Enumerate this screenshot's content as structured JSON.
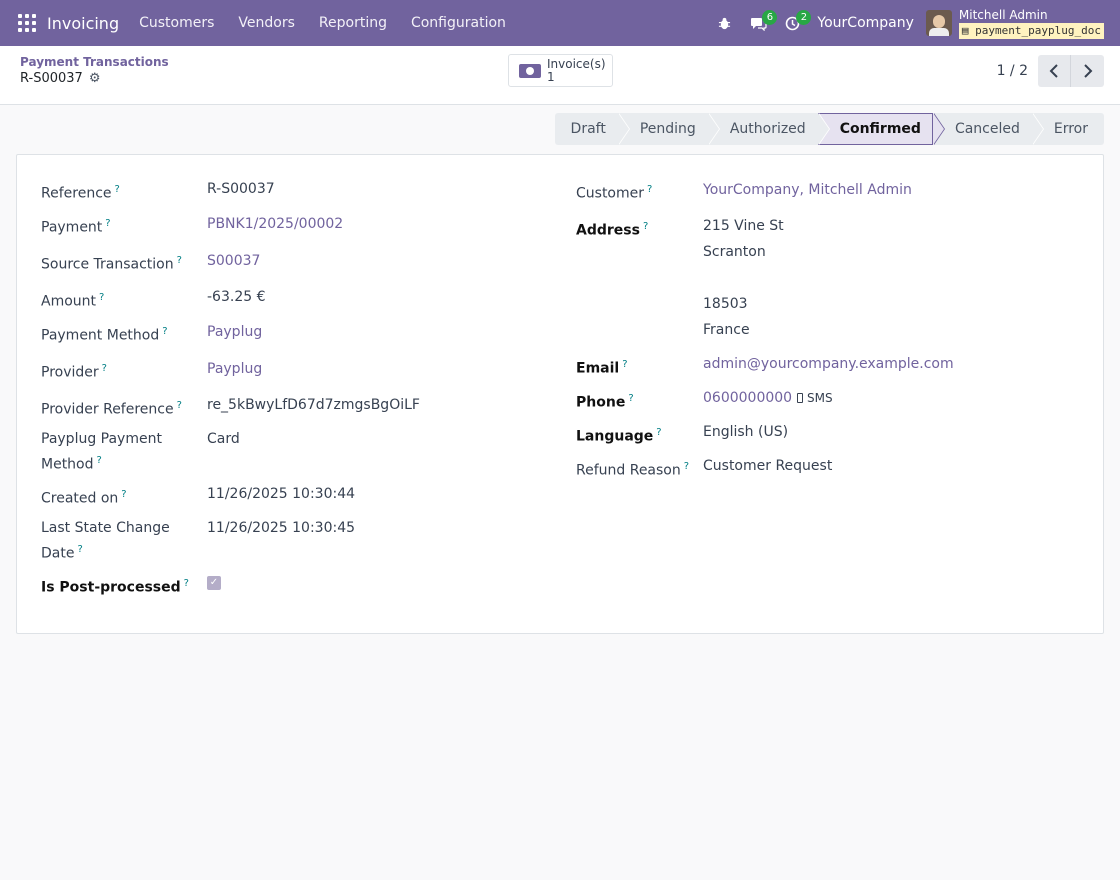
{
  "navbar": {
    "app_name": "Invoicing",
    "menu": [
      "Customers",
      "Vendors",
      "Reporting",
      "Configuration"
    ],
    "messages_count": "6",
    "activities_count": "2",
    "company": "YourCompany",
    "user_name": "Mitchell Admin",
    "database": "payment_payplug_doc"
  },
  "control": {
    "breadcrumb": "Payment Transactions",
    "record_name": "R-S00037",
    "smart_button_label": "Invoice(s)",
    "smart_button_count": "1",
    "pager": "1 / 2"
  },
  "status_stages": [
    "Draft",
    "Pending",
    "Authorized",
    "Confirmed",
    "Canceled",
    "Error"
  ],
  "active_stage": "Confirmed",
  "left_fields": {
    "reference": {
      "label": "Reference",
      "value": "R-S00037"
    },
    "payment": {
      "label": "Payment",
      "value": "PBNK1/2025/00002"
    },
    "source_transaction": {
      "label": "Source Transaction",
      "value": "S00037"
    },
    "amount": {
      "label": "Amount",
      "value": "-63.25 €"
    },
    "payment_method": {
      "label": "Payment Method",
      "value": "Payplug"
    },
    "provider": {
      "label": "Provider",
      "value": "Payplug"
    },
    "provider_reference": {
      "label": "Provider Reference",
      "value": "re_5kBwyLfD67d7zmgsBgOiLF"
    },
    "payplug_payment_method": {
      "label_line1": "Payplug Payment",
      "label_line2": "Method",
      "value": "Card"
    },
    "created_on": {
      "label": "Created on",
      "value": "11/26/2025 10:30:44"
    },
    "last_state_change": {
      "label_line1": "Last State Change",
      "label_line2": "Date",
      "value": "11/26/2025 10:30:45"
    },
    "is_post_processed": {
      "label": "Is Post-processed",
      "checked": true
    }
  },
  "right_fields": {
    "customer": {
      "label": "Customer",
      "value": "YourCompany, Mitchell Admin"
    },
    "address": {
      "label": "Address",
      "street": "215 Vine St",
      "city": "Scranton",
      "zip": "18503",
      "country": "France"
    },
    "email": {
      "label": "Email",
      "value": "admin@yourcompany.example.com"
    },
    "phone": {
      "label": "Phone",
      "value": "0600000000",
      "sms_label": "SMS"
    },
    "language": {
      "label": "Language",
      "value": "English (US)"
    },
    "refund_reason": {
      "label": "Refund Reason",
      "value": "Customer Request"
    }
  },
  "help_marker": "?",
  "colors": {
    "brand": "#71639e",
    "help": "#017e84",
    "badge": "#28a745"
  },
  "icons": [
    "apps-icon",
    "bug-icon",
    "chat-icon",
    "clock-icon",
    "gear-icon",
    "money-icon",
    "chevron-left-icon",
    "chevron-right-icon",
    "phone-icon",
    "database-icon",
    "check-icon"
  ]
}
